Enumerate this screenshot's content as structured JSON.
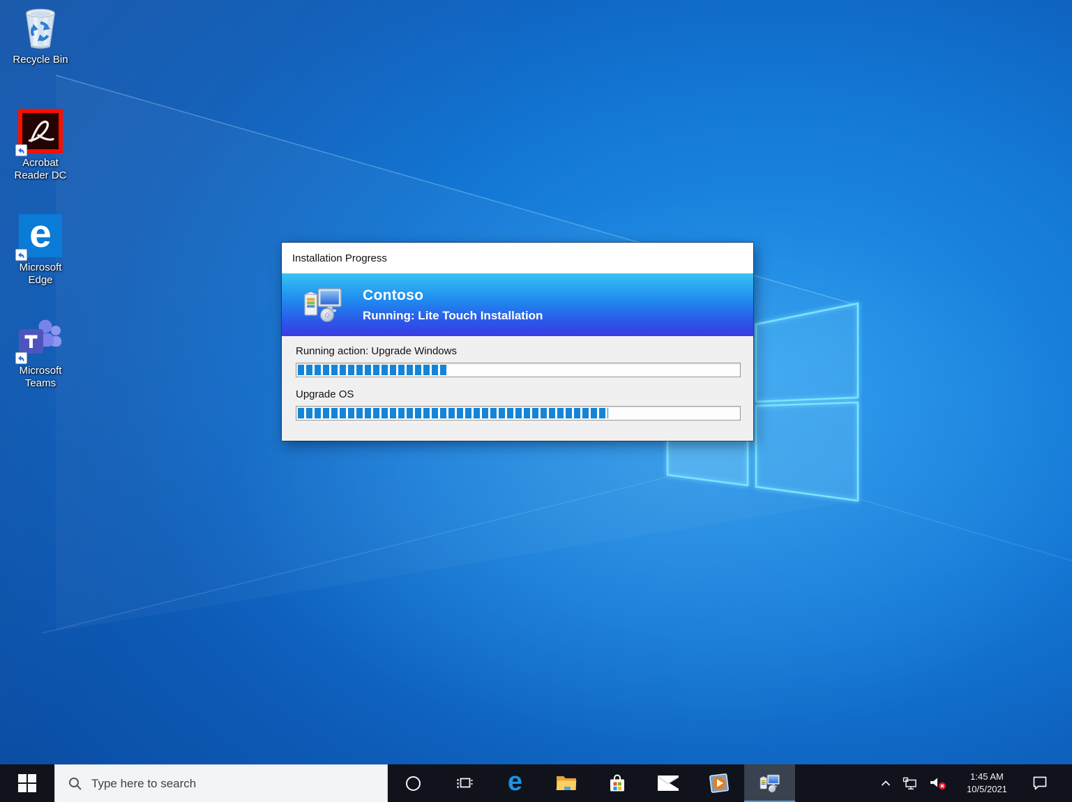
{
  "desktop": {
    "icons": [
      {
        "name": "recycle-bin",
        "lines": [
          "Recycle Bin"
        ]
      },
      {
        "name": "acrobat-reader-dc",
        "lines": [
          "Acrobat",
          "Reader DC"
        ]
      },
      {
        "name": "microsoft-edge",
        "lines": [
          "Microsoft",
          "Edge"
        ]
      },
      {
        "name": "microsoft-teams",
        "lines": [
          "Microsoft",
          "Teams"
        ]
      }
    ]
  },
  "dialog": {
    "title": "Installation Progress",
    "brand": "Contoso",
    "status": "Running: Lite Touch Installation",
    "tasks": [
      {
        "label": "Running action: Upgrade Windows",
        "percent": 34
      },
      {
        "label": "Upgrade OS",
        "percent": 70
      }
    ],
    "colors": {
      "header_gradient_top": "#38c2f4",
      "header_gradient_bottom": "#3c3ce4",
      "progress_fill": "#1484d8",
      "body_bg": "#f0f0f0",
      "titlebar_bg": "#ffffff"
    }
  },
  "taskbar": {
    "search": {
      "placeholder": "Type here to search"
    },
    "buttons": [
      {
        "name": "start"
      },
      {
        "name": "cortana"
      },
      {
        "name": "task-view"
      },
      {
        "name": "edge"
      },
      {
        "name": "file-explorer"
      },
      {
        "name": "microsoft-store"
      },
      {
        "name": "mail"
      },
      {
        "name": "media-player"
      },
      {
        "name": "windows-installer",
        "active": true
      }
    ],
    "tray": {
      "time": "1:45 AM",
      "date": "10/5/2021",
      "icons": [
        {
          "name": "hidden-icons-chevron"
        },
        {
          "name": "network-ethernet"
        },
        {
          "name": "volume-muted"
        },
        {
          "name": "action-center"
        }
      ]
    }
  },
  "glyphs": {
    "edge_e": "e"
  }
}
